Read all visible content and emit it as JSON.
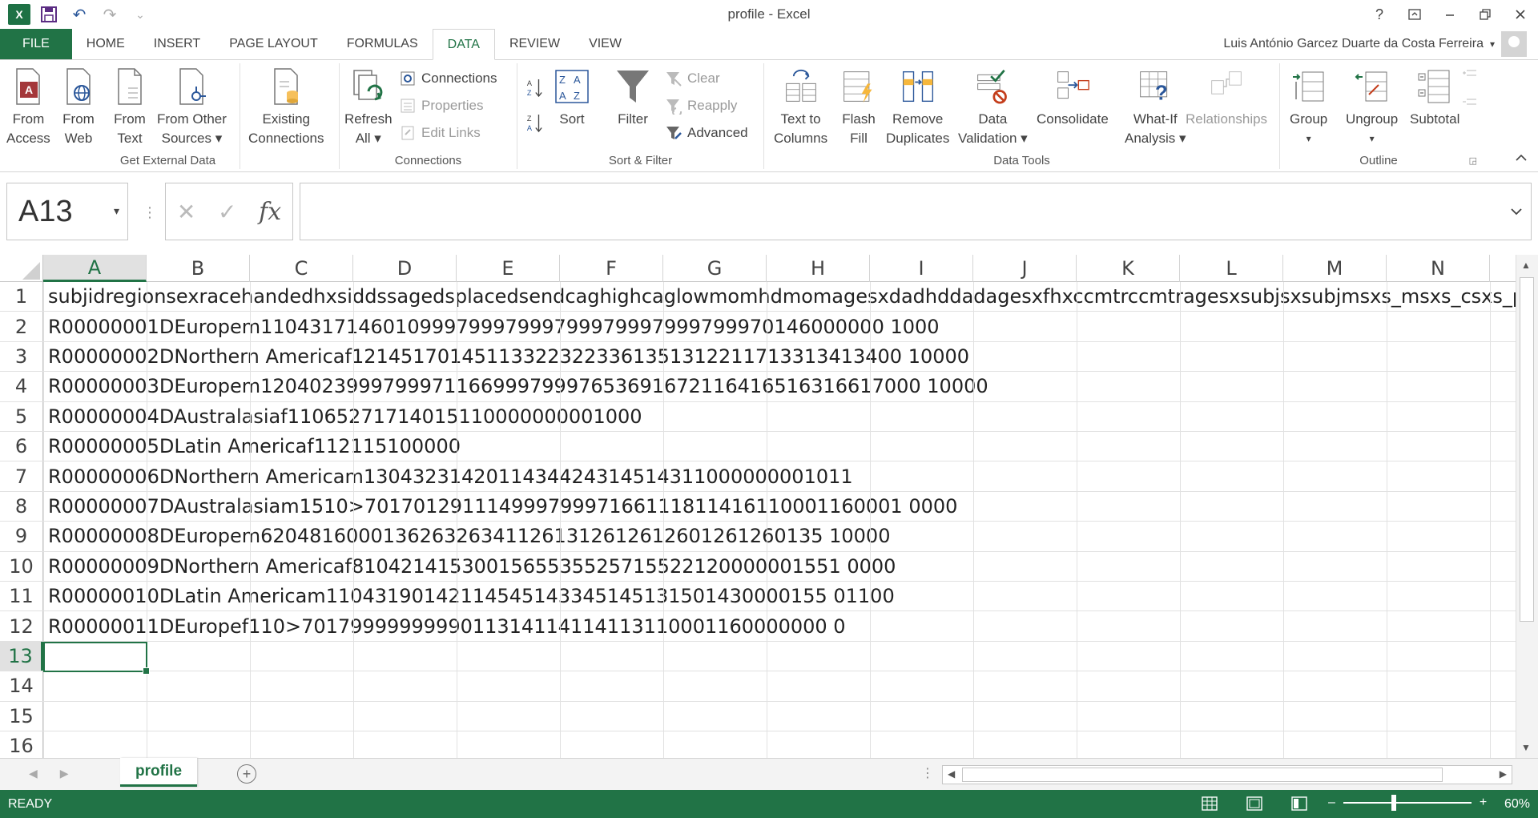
{
  "window": {
    "title": "profile - Excel",
    "help": "?",
    "icons": [
      "ribbon-display-icon",
      "minimize-icon",
      "restore-icon",
      "close-icon"
    ]
  },
  "quick_access": {
    "logo_text": "X",
    "undo": "↶",
    "redo": "↷",
    "customize": "⌄"
  },
  "tabs": [
    "FILE",
    "HOME",
    "INSERT",
    "PAGE LAYOUT",
    "FORMULAS",
    "DATA",
    "REVIEW",
    "VIEW"
  ],
  "active_tab": "DATA",
  "user_name": "Luis António Garcez Duarte da Costa Ferreira",
  "ribbon": {
    "get_external_data": {
      "label": "Get External Data",
      "from_access": [
        "From",
        "Access"
      ],
      "from_web": [
        "From",
        "Web"
      ],
      "from_text": [
        "From",
        "Text"
      ],
      "from_other": [
        "From Other",
        "Sources ▾"
      ],
      "existing": [
        "Existing",
        "Connections"
      ]
    },
    "connections": {
      "label": "Connections",
      "refresh": [
        "Refresh",
        "All ▾"
      ],
      "connections": "Connections",
      "properties": "Properties",
      "edit_links": "Edit Links"
    },
    "sort_filter": {
      "label": "Sort & Filter",
      "sort": "Sort",
      "filter": "Filter",
      "clear": "Clear",
      "reapply": "Reapply",
      "advanced": "Advanced"
    },
    "data_tools": {
      "label": "Data Tools",
      "text_to_columns": [
        "Text to",
        "Columns"
      ],
      "flash_fill": [
        "Flash",
        "Fill"
      ],
      "remove_duplicates": [
        "Remove",
        "Duplicates"
      ],
      "data_validation": [
        "Data",
        "Validation ▾"
      ],
      "consolidate": "Consolidate",
      "what_if": [
        "What-If",
        "Analysis ▾"
      ],
      "relationships": "Relationships"
    },
    "outline": {
      "label": "Outline",
      "group": [
        "Group",
        "▾"
      ],
      "ungroup": [
        "Ungroup",
        "▾"
      ],
      "subtotal": "Subtotal"
    }
  },
  "formula_bar": {
    "name_box": "A13",
    "fx": "fx",
    "cancel": "✕",
    "enter": "✓",
    "value": ""
  },
  "columns": [
    "A",
    "B",
    "C",
    "D",
    "E",
    "F",
    "G",
    "H",
    "I",
    "J",
    "K",
    "L",
    "M",
    "N"
  ],
  "selected_column": "A",
  "rows": [
    {
      "n": "1",
      "text": "subjidregionsexracehandedhxsiddssagedsplacedsendcaghighcaglowmomhdmomagesxdadhddadagesxfhxccmtrccmtragesxsubjsxsubjmsxs_msxs_csxs_psxs_os"
    },
    {
      "n": "2",
      "text": "R00000001DEuropem110431714601099979997999799979997999799970146000000 1000"
    },
    {
      "n": "3",
      "text": "R00000002DNorthern Americaf121451701451133223223361351312211713313413400 10000"
    },
    {
      "n": "4",
      "text": "R00000003DEuropem120402399979997116699979997653691672116416516316617000 10000"
    },
    {
      "n": "5",
      "text": "R00000004DAustralasiaf11065271714015110000000001000"
    },
    {
      "n": "6",
      "text": "R00000005DLatin Americaf112115100000"
    },
    {
      "n": "7",
      "text": "R00000006DNorthern Americam1304323142011434424314514311000000001011"
    },
    {
      "n": "8",
      "text": "R00000007DAustralasiam1510>70170129111499979997166111811416110001160001 0000"
    },
    {
      "n": "9",
      "text": "R00000008DEuropem6204816000136263263411261312612612601261260135 10000"
    },
    {
      "n": "10",
      "text": "R00000009DNorthern Americaf8104214153001565535525715522120000001551 0000"
    },
    {
      "n": "11",
      "text": "R00000010DLatin Americam11043190142114545143345145131501430000155 01100"
    },
    {
      "n": "12",
      "text": "R00000011DEuropef110>7017999999999011314114114113110001160000000 0"
    },
    {
      "n": "13",
      "text": ""
    },
    {
      "n": "14",
      "text": ""
    },
    {
      "n": "15",
      "text": ""
    },
    {
      "n": "16",
      "text": ""
    }
  ],
  "selected_row": "13",
  "sheet": {
    "active": "profile",
    "add": "+"
  },
  "status": {
    "text": "READY",
    "zoom": "60%",
    "zoom_minus": "–",
    "zoom_plus": "+"
  }
}
